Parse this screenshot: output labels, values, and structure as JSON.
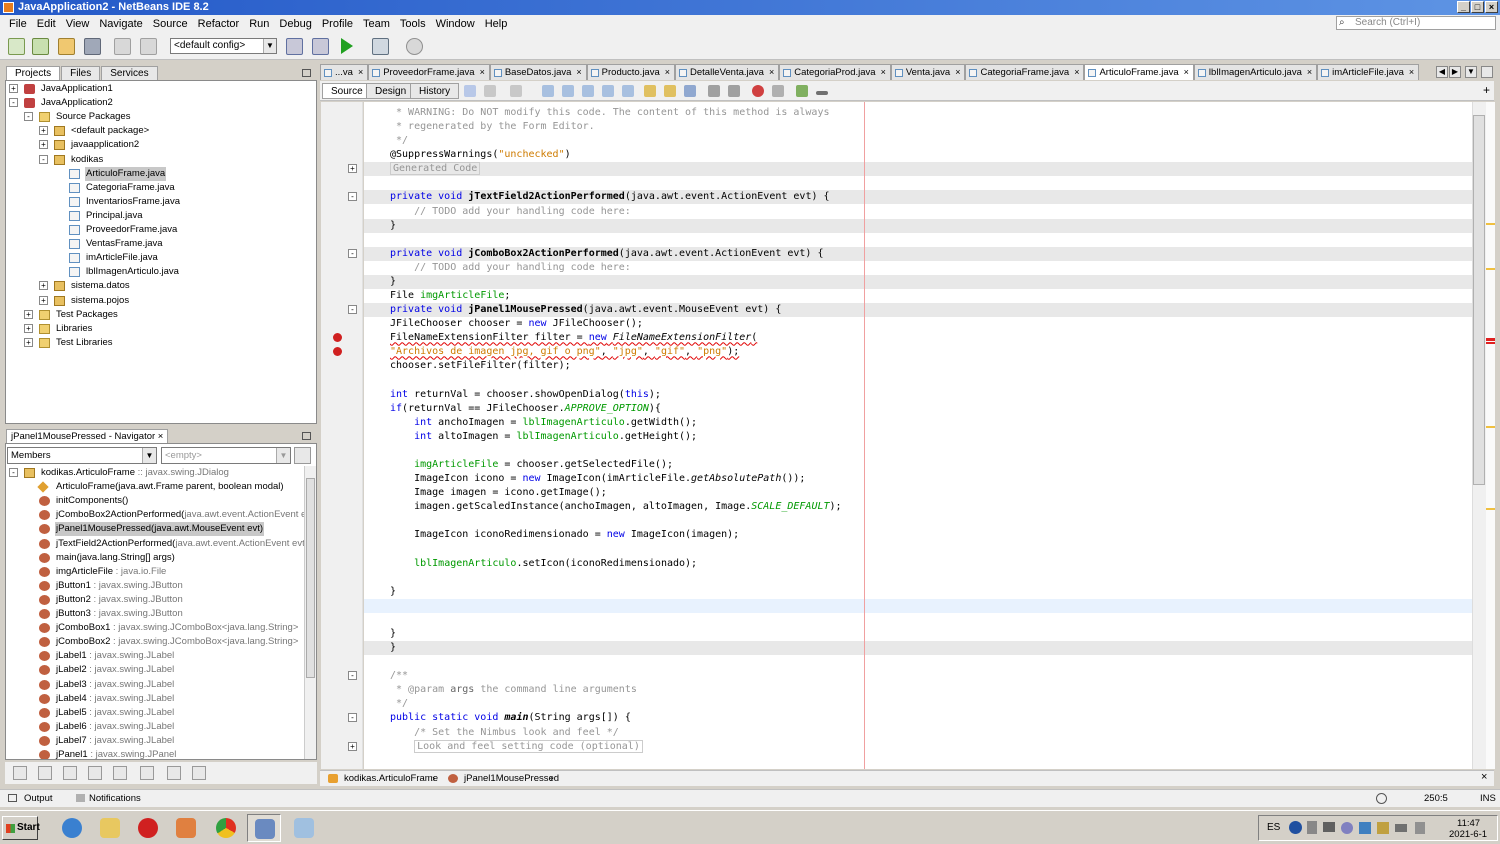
{
  "window": {
    "title": "JavaApplication2 - NetBeans IDE 8.2"
  },
  "menu": [
    "File",
    "Edit",
    "View",
    "Navigate",
    "Source",
    "Refactor",
    "Run",
    "Debug",
    "Profile",
    "Team",
    "Tools",
    "Window",
    "Help"
  ],
  "search": {
    "placeholder": "Search (Ctrl+I)"
  },
  "toolbar": {
    "config": "<default config>"
  },
  "projects_panel": {
    "tabs": [
      "Projects",
      "Files",
      "Services"
    ],
    "tree": [
      {
        "indent": 0,
        "exp": "+",
        "icon": "proj",
        "label": "JavaApplication1"
      },
      {
        "indent": 0,
        "exp": "-",
        "icon": "proj",
        "label": "JavaApplication2"
      },
      {
        "indent": 1,
        "exp": "-",
        "icon": "folder",
        "label": "Source Packages"
      },
      {
        "indent": 2,
        "exp": "+",
        "icon": "pkg",
        "label": "<default package>"
      },
      {
        "indent": 2,
        "exp": "+",
        "icon": "pkg",
        "label": "javaapplication2"
      },
      {
        "indent": 2,
        "exp": "-",
        "icon": "pkg",
        "label": "kodikas"
      },
      {
        "indent": 3,
        "exp": "",
        "icon": "java",
        "label": "ArticuloFrame.java",
        "selected": true
      },
      {
        "indent": 3,
        "exp": "",
        "icon": "java",
        "label": "CategoriaFrame.java"
      },
      {
        "indent": 3,
        "exp": "",
        "icon": "java",
        "label": "InventariosFrame.java"
      },
      {
        "indent": 3,
        "exp": "",
        "icon": "java",
        "label": "Principal.java"
      },
      {
        "indent": 3,
        "exp": "",
        "icon": "java",
        "label": "ProveedorFrame.java"
      },
      {
        "indent": 3,
        "exp": "",
        "icon": "java",
        "label": "VentasFrame.java"
      },
      {
        "indent": 3,
        "exp": "",
        "icon": "java",
        "label": "imArticleFile.java"
      },
      {
        "indent": 3,
        "exp": "",
        "icon": "java",
        "label": "lblImagenArticulo.java"
      },
      {
        "indent": 2,
        "exp": "+",
        "icon": "pkg",
        "label": "sistema.datos"
      },
      {
        "indent": 2,
        "exp": "+",
        "icon": "pkg",
        "label": "sistema.pojos"
      },
      {
        "indent": 1,
        "exp": "+",
        "icon": "folder",
        "label": "Test Packages"
      },
      {
        "indent": 1,
        "exp": "+",
        "icon": "folder",
        "label": "Libraries"
      },
      {
        "indent": 1,
        "exp": "+",
        "icon": "folder",
        "label": "Test Libraries"
      }
    ]
  },
  "navigator": {
    "title": "jPanel1MousePressed - Navigator",
    "filter": "Members",
    "empty": "<empty>",
    "items": [
      {
        "indent": 0,
        "icon": "class",
        "name": "kodikas.ArticuloFrame",
        "type": " :: javax.swing.JDialog"
      },
      {
        "indent": 1,
        "icon": "method",
        "name": "ArticuloFrame(java.awt.Frame parent, boolean modal)",
        "type": ""
      },
      {
        "indent": 1,
        "icon": "field",
        "name": "initComponents()",
        "type": ""
      },
      {
        "indent": 1,
        "icon": "field",
        "name": "jComboBox2ActionPerformed(",
        "type": "java.awt.event.ActionEvent evt)"
      },
      {
        "indent": 1,
        "icon": "field",
        "name": "jPanel1MousePressed(java.awt.MouseEvent evt)",
        "type": "",
        "selected": true
      },
      {
        "indent": 1,
        "icon": "field",
        "name": "jTextField2ActionPerformed(",
        "type": "java.awt.event.ActionEvent evt)"
      },
      {
        "indent": 1,
        "icon": "field",
        "name": "main(java.lang.String[] args)",
        "type": ""
      },
      {
        "indent": 1,
        "icon": "field",
        "name": "imgArticleFile",
        "type": " : java.io.File"
      },
      {
        "indent": 1,
        "icon": "field",
        "name": "jButton1",
        "type": " : javax.swing.JButton"
      },
      {
        "indent": 1,
        "icon": "field",
        "name": "jButton2",
        "type": " : javax.swing.JButton"
      },
      {
        "indent": 1,
        "icon": "field",
        "name": "jButton3",
        "type": " : javax.swing.JButton"
      },
      {
        "indent": 1,
        "icon": "field",
        "name": "jComboBox1",
        "type": " : javax.swing.JComboBox<java.lang.String>"
      },
      {
        "indent": 1,
        "icon": "field",
        "name": "jComboBox2",
        "type": " : javax.swing.JComboBox<java.lang.String>"
      },
      {
        "indent": 1,
        "icon": "field",
        "name": "jLabel1",
        "type": " : javax.swing.JLabel"
      },
      {
        "indent": 1,
        "icon": "field",
        "name": "jLabel2",
        "type": " : javax.swing.JLabel"
      },
      {
        "indent": 1,
        "icon": "field",
        "name": "jLabel3",
        "type": " : javax.swing.JLabel"
      },
      {
        "indent": 1,
        "icon": "field",
        "name": "jLabel4",
        "type": " : javax.swing.JLabel"
      },
      {
        "indent": 1,
        "icon": "field",
        "name": "jLabel5",
        "type": " : javax.swing.JLabel"
      },
      {
        "indent": 1,
        "icon": "field",
        "name": "jLabel6",
        "type": " : javax.swing.JLabel"
      },
      {
        "indent": 1,
        "icon": "field",
        "name": "jLabel7",
        "type": " : javax.swing.JLabel"
      },
      {
        "indent": 1,
        "icon": "field",
        "name": "jPanel1",
        "type": " : javax.swing.JPanel"
      }
    ]
  },
  "editor_tabs": [
    {
      "label": "...va",
      "active": false
    },
    {
      "label": "ProveedorFrame.java",
      "active": false
    },
    {
      "label": "BaseDatos.java",
      "active": false
    },
    {
      "label": "Producto.java",
      "active": false
    },
    {
      "label": "DetalleVenta.java",
      "active": false
    },
    {
      "label": "CategoriaProd.java",
      "active": false
    },
    {
      "label": "Venta.java",
      "active": false
    },
    {
      "label": "CategoriaFrame.java",
      "active": false
    },
    {
      "label": "ArticuloFrame.java",
      "active": true
    },
    {
      "label": "lblImagenArticulo.java",
      "active": false
    },
    {
      "label": "imArticleFile.java",
      "active": false
    }
  ],
  "source_bar": {
    "source": "Source",
    "design": "Design",
    "history": "History"
  },
  "code_lines": [
    {
      "html": "<span class=\"cm\"> * WARNING: Do NOT modify this code. The content of this method is always</span>"
    },
    {
      "html": "<span class=\"cm\"> * regenerated by the Form Editor.</span>"
    },
    {
      "html": "<span class=\"cm\"> */</span>"
    },
    {
      "html": "@SuppressWarnings(<span class=\"str\">\"unchecked\"</span>)"
    },
    {
      "html": "<span class=\"cm\" style=\"border:1px solid #ccc;padding:0 2px\">Generated Code</span>",
      "band": true,
      "fold": "+"
    },
    {
      "html": ""
    },
    {
      "html": "<span class=\"kw\">private void</span> <span class=\"fn\">jTextField2ActionPerformed</span>(java.awt.event.ActionEvent evt) {",
      "band": true,
      "fold": "-"
    },
    {
      "html": "    <span class=\"cm\">// TODO add your handling code here:</span>"
    },
    {
      "html": "}",
      "band": true
    },
    {
      "html": ""
    },
    {
      "html": "<span class=\"kw\">private void</span> <span class=\"fn\">jComboBox2ActionPerformed</span>(java.awt.event.ActionEvent evt) {",
      "band": true,
      "fold": "-"
    },
    {
      "html": "    <span class=\"cm\">// TODO add your handling code here:</span>"
    },
    {
      "html": "}",
      "band": true
    },
    {
      "html": "File <span class=\"fld\">imgArticleFile</span>;"
    },
    {
      "html": "<span class=\"kw\">private void</span> <span class=\"fn\">jPanel1MousePressed</span>(java.awt.event.MouseEvent evt) {",
      "band": true,
      "fold": "-"
    },
    {
      "html": "JFileChooser chooser = <span class=\"kw\">new</span> JFileChooser();"
    },
    {
      "html": "<span class=\"err\">FileNameExtensionFilter filter = <span class=\"kw\">new</span> <span class=\"it\">FileNameExtensionFilter</span>(</span>",
      "error": true
    },
    {
      "html": "<span class=\"err\"><span class=\"str\">\"Archivos de imagen jpg, gif o png\"</span>, <span class=\"str\">\"jpg\"</span>, <span class=\"str\">\"gif\"</span>, <span class=\"str\">\"png\"</span>);</span>",
      "error": true
    },
    {
      "html": "chooser.setFileFilter(filter);"
    },
    {
      "html": ""
    },
    {
      "html": "<span class=\"kw\">int</span> returnVal = chooser.showOpenDialog(<span class=\"kw\">this</span>);"
    },
    {
      "html": "<span class=\"kw\">if</span>(returnVal == JFileChooser.<span class=\"fld it\">APPROVE_OPTION</span>){"
    },
    {
      "html": "    <span class=\"kw\">int</span> anchoImagen = <span class=\"fld\">lblImagenArticulo</span>.getWidth();"
    },
    {
      "html": "    <span class=\"kw\">int</span> altoImagen = <span class=\"fld\">lblImagenArticulo</span>.getHeight();"
    },
    {
      "html": ""
    },
    {
      "html": "    <span class=\"fld\">imgArticleFile</span> = chooser.getSelectedFile();"
    },
    {
      "html": "    ImageIcon icono = <span class=\"kw\">new</span> ImageIcon(imArticleFile.<span class=\"it\">getAbsolutePath</span>());"
    },
    {
      "html": "    Image imagen = icono.getImage();"
    },
    {
      "html": "    imagen.getScaledInstance(anchoImagen, altoImagen, Image.<span class=\"fld it\">SCALE_DEFAULT</span>);"
    },
    {
      "html": ""
    },
    {
      "html": "    ImageIcon iconoRedimensionado = <span class=\"kw\">new</span> ImageIcon(imagen);"
    },
    {
      "html": ""
    },
    {
      "html": "    <span class=\"fld\">lblImagenArticulo</span>.setIcon(iconoRedimensionado);"
    },
    {
      "html": ""
    },
    {
      "html": "}"
    },
    {
      "html": "",
      "current": true
    },
    {
      "html": ""
    },
    {
      "html": "}"
    },
    {
      "html": "}",
      "band": true
    },
    {
      "html": ""
    },
    {
      "html": "<span class=\"cm\">/**</span>",
      "fold": "-"
    },
    {
      "html": "<span class=\"cm\"> * @param <b style=\"color:#666;font-weight:normal\">args</b> the command line arguments</span>"
    },
    {
      "html": "<span class=\"cm\"> */</span>"
    },
    {
      "html": "<span class=\"kw\">public static void</span> <span class=\"fn it\">main</span>(String args[]) {",
      "fold": "-"
    },
    {
      "html": "    <span class=\"cm\">/* Set the Nimbus look and feel */</span>"
    },
    {
      "html": "    <span class=\"cm\" style=\"border:1px solid #ccc;padding:0 2px\">Look and feel setting code (optional)</span>",
      "fold": "+"
    }
  ],
  "breadcrumb": [
    "kodikas.ArticuloFrame",
    "jPanel1MousePressed"
  ],
  "bottom": {
    "output": "Output",
    "notifications": "Notifications",
    "position": "250:5",
    "mode": "INS"
  },
  "taskbar": {
    "start": "Start",
    "lang": "ES",
    "time": "11:47",
    "date": "2021-6-1"
  },
  "colors": {
    "accent": "#2459c8",
    "keyword": "#0000e6",
    "comment": "#969696",
    "string": "#ce7b00",
    "field": "#009900",
    "error": "#d02020"
  }
}
